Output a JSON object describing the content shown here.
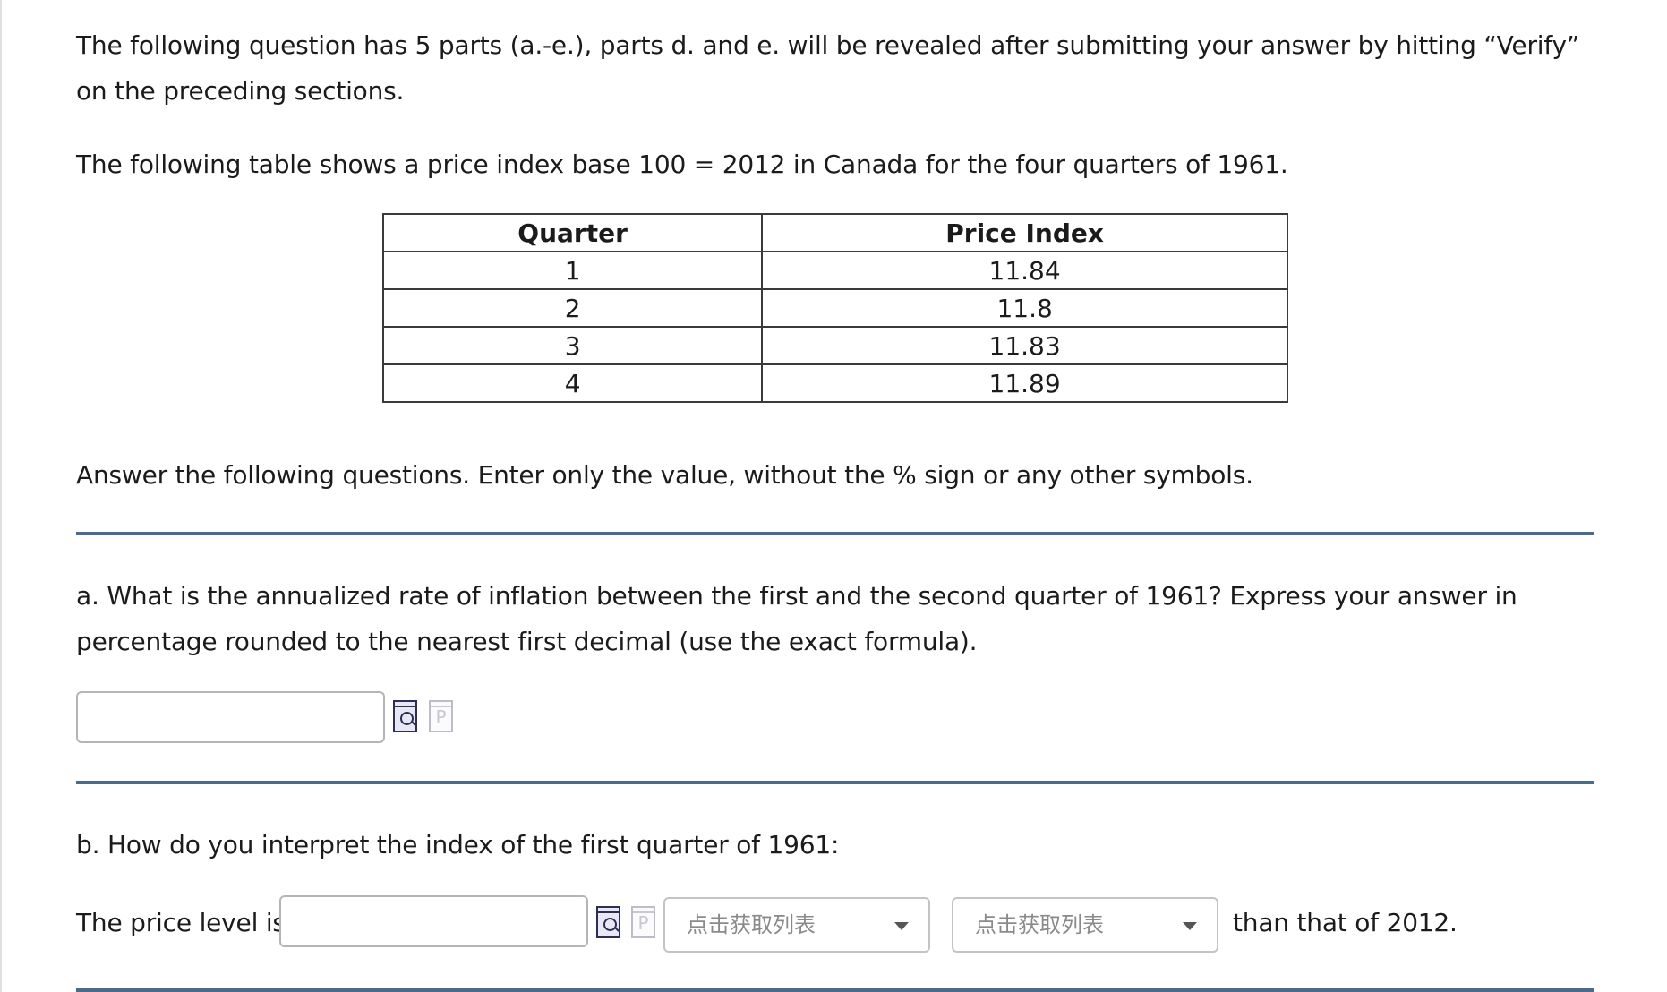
{
  "intro": "The following question has 5 parts (a.-e.), parts d. and e. will be revealed after submitting your answer by hitting “Verify” on the preceding sections.",
  "table_description": "The following table shows a price index base 100 = 2012 in Canada for the four quarters of 1961.",
  "table": {
    "headers": [
      "Quarter",
      "Price Index"
    ],
    "rows": [
      [
        "1",
        "11.84"
      ],
      [
        "2",
        "11.8"
      ],
      [
        "3",
        "11.83"
      ],
      [
        "4",
        "11.89"
      ]
    ]
  },
  "answer_instructions": "Answer the following questions. Enter only the value, without the % sign or any other symbols.",
  "part_a": {
    "question": "a. What is the annualized rate of inflation between the first and the second quarter of 1961? Express your answer in percentage rounded to the nearest first decimal (use the exact formula).",
    "input_value": ""
  },
  "part_b": {
    "question": "b. How do you interpret the index of the first quarter of 1961:",
    "prefix": "The price level is",
    "input_value": "",
    "select1_value": "点击获取列表",
    "select2_value": "点击获取列表",
    "suffix": "than that of 2012."
  },
  "icons": {
    "preview": "preview-magnifier-icon",
    "paste": "p-document-icon",
    "p_glyph": "P"
  },
  "colors": {
    "divider": "#4a6b8c",
    "input_border": "#b5b5b5"
  }
}
